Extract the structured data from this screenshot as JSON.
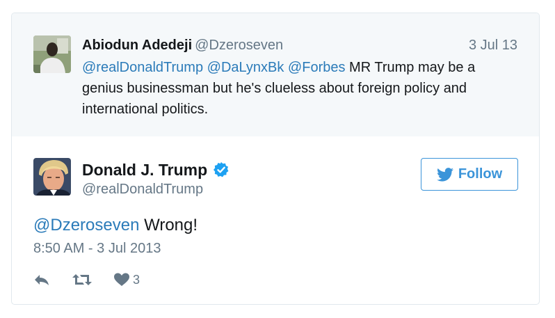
{
  "quoted_tweet": {
    "author_name": "Abiodun Adedeji",
    "author_handle": "@Dzeroseven",
    "date": "3 Jul 13",
    "mention_1": "@realDonaldTrump",
    "mention_2": "@DaLynxBk",
    "mention_3": "@Forbes",
    "text_body": "MR Trump may be a genius businessman but he's clueless about foreign policy and international politics."
  },
  "tweet": {
    "author_name": "Donald J. Trump",
    "author_handle": "@realDonaldTrump",
    "verified": true,
    "reply_mention": "@Dzeroseven",
    "text_body": "Wrong!",
    "timestamp": "8:50 AM - 3 Jul 2013",
    "like_count": "3"
  },
  "follow_button": {
    "label": "Follow",
    "icon": "twitter-bird-icon"
  },
  "actions": {
    "icons": [
      "reply-icon",
      "retweet-icon",
      "heart-icon"
    ]
  },
  "colors": {
    "link": "#2b7bb9",
    "accent": "#3b94d9",
    "verified": "#1da1f2",
    "muted": "#657786",
    "text": "#14171a",
    "quoted_bg": "#f5f8fa",
    "border": "#e1e8ed"
  }
}
